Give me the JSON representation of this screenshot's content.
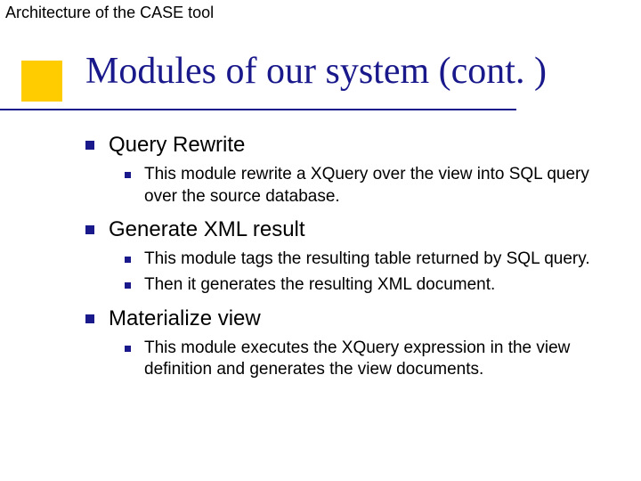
{
  "header": "Architecture of the CASE tool",
  "title": "Modules of our system (cont. )",
  "sections": [
    {
      "heading": "Query Rewrite",
      "items": [
        "This module rewrite a XQuery over the view into SQL query over the source database."
      ]
    },
    {
      "heading": "Generate XML result",
      "items": [
        "This module tags the resulting table returned by SQL query.",
        "Then it generates the resulting XML document."
      ]
    },
    {
      "heading": "Materialize view",
      "items": [
        "This module executes the XQuery expression in the view definition and generates the view documents."
      ]
    }
  ]
}
